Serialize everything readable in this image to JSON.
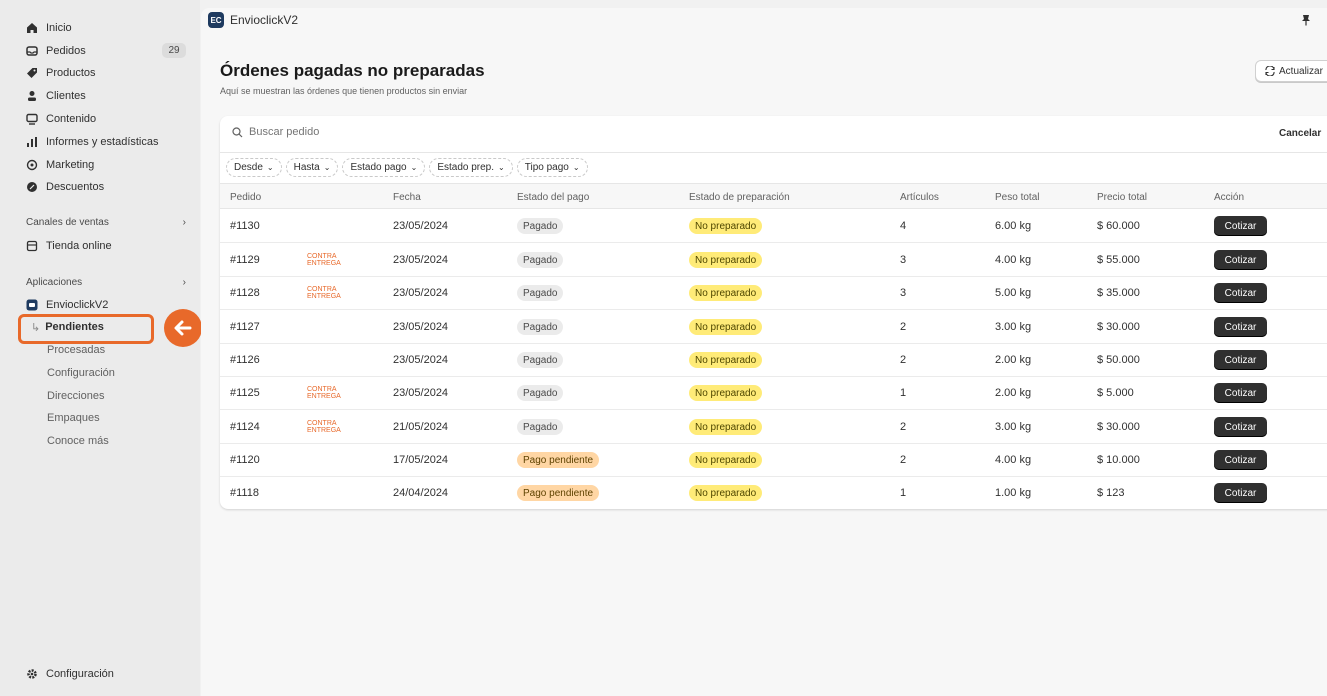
{
  "sidebar": {
    "main_items": [
      {
        "label": "Inicio",
        "icon": "home-icon"
      },
      {
        "label": "Pedidos",
        "icon": "inbox-icon",
        "badge": "29"
      },
      {
        "label": "Productos",
        "icon": "tag-icon"
      },
      {
        "label": "Clientes",
        "icon": "person-icon"
      },
      {
        "label": "Contenido",
        "icon": "content-icon"
      },
      {
        "label": "Informes y estadísticas",
        "icon": "chart-icon"
      },
      {
        "label": "Marketing",
        "icon": "target-icon"
      },
      {
        "label": "Descuentos",
        "icon": "discount-icon"
      }
    ],
    "sales_channels_title": "Canales de ventas",
    "sales_channel_item": "Tienda online",
    "apps_title": "Aplicaciones",
    "app_item": "EnvioclickV2",
    "app_subitems": [
      "Pendientes",
      "Procesadas",
      "Configuración",
      "Direcciones",
      "Empaques",
      "Conoce más"
    ],
    "footer_item": "Configuración"
  },
  "header": {
    "app_name": "EnvioclickV2"
  },
  "page": {
    "title": "Órdenes pagadas no preparadas",
    "subtitle": "Aquí se muestran las órdenes que tienen productos sin enviar",
    "refresh_label": "Actualizar"
  },
  "search": {
    "placeholder": "Buscar pedido",
    "cancel_label": "Cancelar"
  },
  "filters": [
    "Desde",
    "Hasta",
    "Estado pago",
    "Estado prep.",
    "Tipo pago"
  ],
  "table": {
    "columns": [
      "Pedido",
      "Fecha",
      "Estado del pago",
      "Estado de preparación",
      "Artículos",
      "Peso total",
      "Precio total",
      "Acción"
    ],
    "contra_label_1": "CONTRA",
    "contra_label_2": "ENTREGA",
    "action_label": "Cotizar",
    "rows": [
      {
        "order": "#1130",
        "contra": false,
        "date": "23/05/2024",
        "payment": "Pagado",
        "payment_status": "paid",
        "prep": "No preparado",
        "items": "4",
        "weight": "6.00 kg",
        "price": "$ 60.000"
      },
      {
        "order": "#1129",
        "contra": true,
        "date": "23/05/2024",
        "payment": "Pagado",
        "payment_status": "paid",
        "prep": "No preparado",
        "items": "3",
        "weight": "4.00 kg",
        "price": "$ 55.000"
      },
      {
        "order": "#1128",
        "contra": true,
        "date": "23/05/2024",
        "payment": "Pagado",
        "payment_status": "paid",
        "prep": "No preparado",
        "items": "3",
        "weight": "5.00 kg",
        "price": "$ 35.000"
      },
      {
        "order": "#1127",
        "contra": false,
        "date": "23/05/2024",
        "payment": "Pagado",
        "payment_status": "paid",
        "prep": "No preparado",
        "items": "2",
        "weight": "3.00 kg",
        "price": "$ 30.000"
      },
      {
        "order": "#1126",
        "contra": false,
        "date": "23/05/2024",
        "payment": "Pagado",
        "payment_status": "paid",
        "prep": "No preparado",
        "items": "2",
        "weight": "2.00 kg",
        "price": "$ 50.000"
      },
      {
        "order": "#1125",
        "contra": true,
        "date": "23/05/2024",
        "payment": "Pagado",
        "payment_status": "paid",
        "prep": "No preparado",
        "items": "1",
        "weight": "2.00 kg",
        "price": "$ 5.000"
      },
      {
        "order": "#1124",
        "contra": true,
        "date": "21/05/2024",
        "payment": "Pagado",
        "payment_status": "paid",
        "prep": "No preparado",
        "items": "2",
        "weight": "3.00 kg",
        "price": "$ 30.000"
      },
      {
        "order": "#1120",
        "contra": false,
        "date": "17/05/2024",
        "payment": "Pago pendiente",
        "payment_status": "pending",
        "prep": "No preparado",
        "items": "2",
        "weight": "4.00 kg",
        "price": "$ 10.000"
      },
      {
        "order": "#1118",
        "contra": false,
        "date": "24/04/2024",
        "payment": "Pago pendiente",
        "payment_status": "pending",
        "prep": "No preparado",
        "items": "1",
        "weight": "1.00 kg",
        "price": "$ 123"
      }
    ]
  },
  "colors": {
    "accent": "#e8692a",
    "button_dark": "#303030",
    "badge_not_prepared": "#ffeb78",
    "badge_pending": "#ffd6a4"
  }
}
